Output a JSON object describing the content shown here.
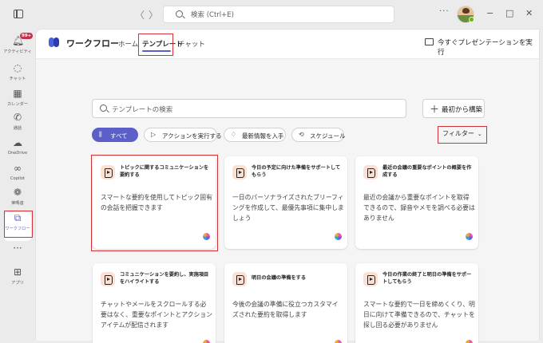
{
  "titlebar": {
    "back": "〈",
    "forward": "〉",
    "search_placeholder": "検索 (Ctrl+E)",
    "more": "···",
    "minimize": "−",
    "maximize": "□",
    "close": "✕"
  },
  "rail": {
    "items": [
      {
        "label": "アクティビティ",
        "icon": "bell-icon",
        "badge": "99+"
      },
      {
        "label": "チャット",
        "icon": "chat-icon"
      },
      {
        "label": "カレンダー",
        "icon": "calendar-icon"
      },
      {
        "label": "通話",
        "icon": "phone-icon"
      },
      {
        "label": "OneDrive",
        "icon": "cloud-icon"
      },
      {
        "label": "Copilot",
        "icon": "copilot-icon"
      },
      {
        "label": "荣嗎音",
        "icon": "apps-icon"
      },
      {
        "label": "ワークフロー",
        "icon": "workflow-icon",
        "active": true
      },
      {
        "label": "",
        "icon": "more-icon"
      },
      {
        "label": "アプリ",
        "icon": "add-app-icon"
      }
    ],
    "more_glyph": "···"
  },
  "header": {
    "app_title": "ワークフロー",
    "tabs": [
      "ホーム",
      "テンプレート",
      "チャット"
    ],
    "active_tab": "テンプレート",
    "present_label": "今すぐプレゼンテーションを実行",
    "more": "···"
  },
  "toolbar": {
    "search_placeholder": "テンプレートの検索",
    "scratch_label": "最初から構築",
    "scratch_plus": "＋",
    "chips": [
      "すべて",
      "アクションを実行する",
      "最新情報を入手",
      "スケジュール"
    ],
    "filter_label": "フィルター",
    "filter_chevron": "⌄"
  },
  "cards": [
    {
      "title": "トピックに関するコミュニケーションを要約する",
      "description": "スマートな要約を使用してトピック固有の会話を把握できます"
    },
    {
      "title": "今日の予定に向けた準備をサポートしてもらう",
      "description": "一日のパーソナライズされたブリーフィングを作成して、最優先事項に集中しましょう"
    },
    {
      "title": "最近の会議の重要なポイントの概要を作成する",
      "description": "最近の会議から重要なポイントを取得できるので、録音やメモを調べる必要はありません"
    },
    {
      "title": "コミュニケーションを要約し、実施項目をハイライトする",
      "description": "チャットやメールをスクロールする必要はなく、重要なポイントとアクション アイテムが配信されます"
    },
    {
      "title": "明日の会議の準備をする",
      "description": "今後の会議の準備に役立つカスタマイズされた要約を取得します"
    },
    {
      "title": "今日の作業の終了と明日の準備をサポートしてもらう",
      "description": "スマートな要約で一日を締めくくり、明日に向けて準備できるので、チャットを探し回る必要がありません"
    }
  ],
  "colors": {
    "accent": "#5b5fc7",
    "highlight": "#d13438",
    "card_icon_bg": "#fbe0d3"
  }
}
